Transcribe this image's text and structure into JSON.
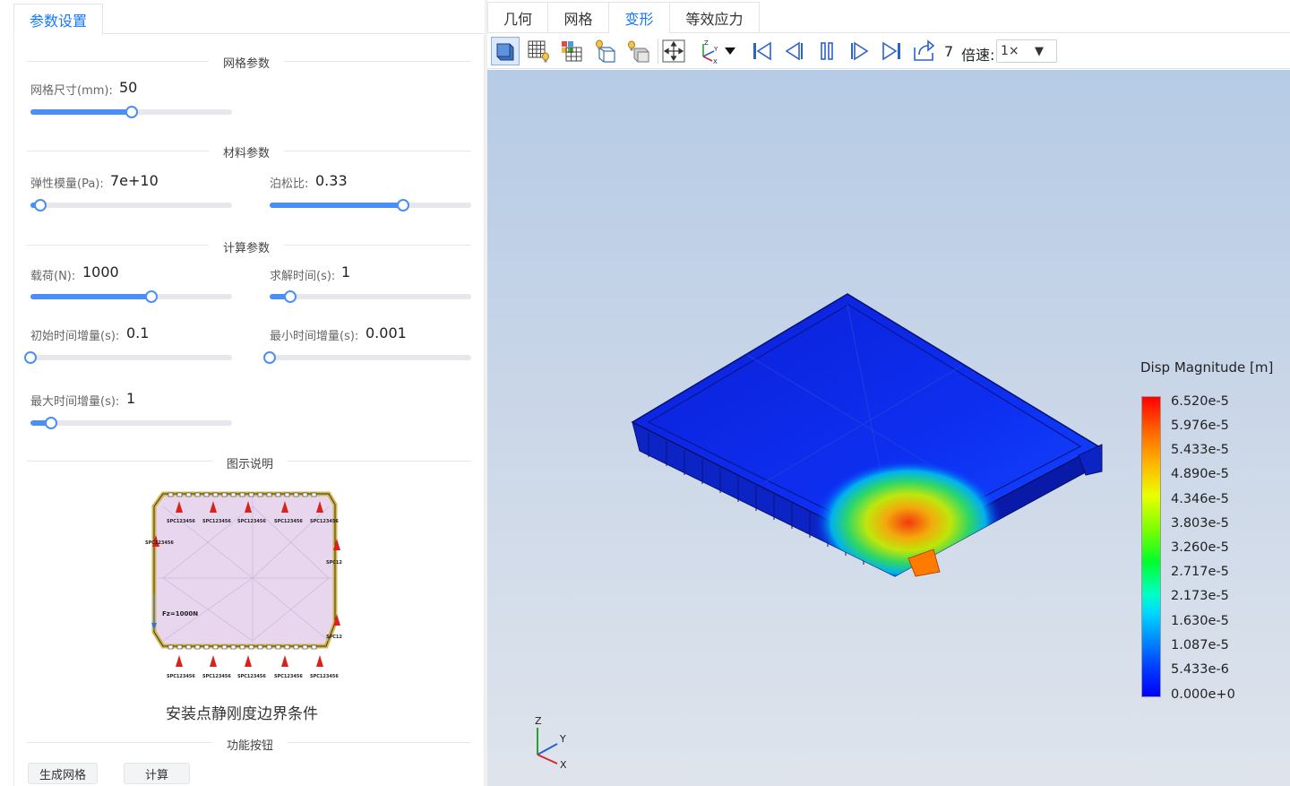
{
  "left_panel": {
    "tab_label": "参数设置",
    "sections": {
      "mesh": "网格参数",
      "material": "材料参数",
      "compute": "计算参数",
      "diagram": "图示说明",
      "buttons": "功能按钮"
    },
    "params": {
      "mesh_size": {
        "label": "网格尺寸(mm):",
        "value": "50",
        "fraction": 0.5
      },
      "elastic_modulus": {
        "label": "弹性模量(Pa):",
        "value": "7e+10",
        "fraction": 0.05
      },
      "poisson_ratio": {
        "label": "泊松比:",
        "value": "0.33",
        "fraction": 0.66
      },
      "load": {
        "label": "载荷(N):",
        "value": "1000",
        "fraction": 0.6
      },
      "solve_time": {
        "label": "求解时间(s):",
        "value": "1",
        "fraction": 0.1
      },
      "init_time_inc": {
        "label": "初始时间增量(s):",
        "value": "0.1",
        "fraction": 0.0
      },
      "min_time_inc": {
        "label": "最小时间增量(s):",
        "value": "0.001",
        "fraction": 0.0
      },
      "max_time_inc": {
        "label": "最大时间增量(s):",
        "value": "1",
        "fraction": 0.1
      }
    },
    "diagram": {
      "caption": "安装点静刚度边界条件",
      "spc_label": "SPC123456",
      "force_label": "Fz=1000N"
    },
    "buttons": {
      "generate_mesh": "生成网格",
      "compute": "计算"
    }
  },
  "right_panel": {
    "tabs": [
      {
        "label": "几何",
        "active": false
      },
      {
        "label": "网格",
        "active": false
      },
      {
        "label": "变形",
        "active": true
      },
      {
        "label": "等效应力",
        "active": false
      }
    ],
    "toolbar": {
      "icons": [
        "surface-view-icon",
        "mesh-view-icon",
        "color-grid-icon",
        "wireframe-light-icon",
        "shaded-light-icon",
        "fit-view-icon",
        "axes-icon"
      ],
      "playback_icons": [
        "first-frame-icon",
        "prev-frame-icon",
        "pause-icon",
        "next-frame-icon",
        "last-frame-icon",
        "export-icon"
      ],
      "frame": "7",
      "speed_label": "倍速:",
      "speed_value": "1×"
    },
    "legend": {
      "title": "Disp Magnitude [m]",
      "ticks": [
        "6.520e-5",
        "5.976e-5",
        "5.433e-5",
        "4.890e-5",
        "4.346e-5",
        "3.803e-5",
        "3.260e-5",
        "2.717e-5",
        "2.173e-5",
        "1.630e-5",
        "1.087e-5",
        "5.433e-6",
        "0.000e+0"
      ],
      "colors": {
        "max": "#ff0000",
        "min": "#0000ff"
      }
    },
    "axes": {
      "x": "X",
      "y": "Y",
      "z": "Z"
    }
  }
}
